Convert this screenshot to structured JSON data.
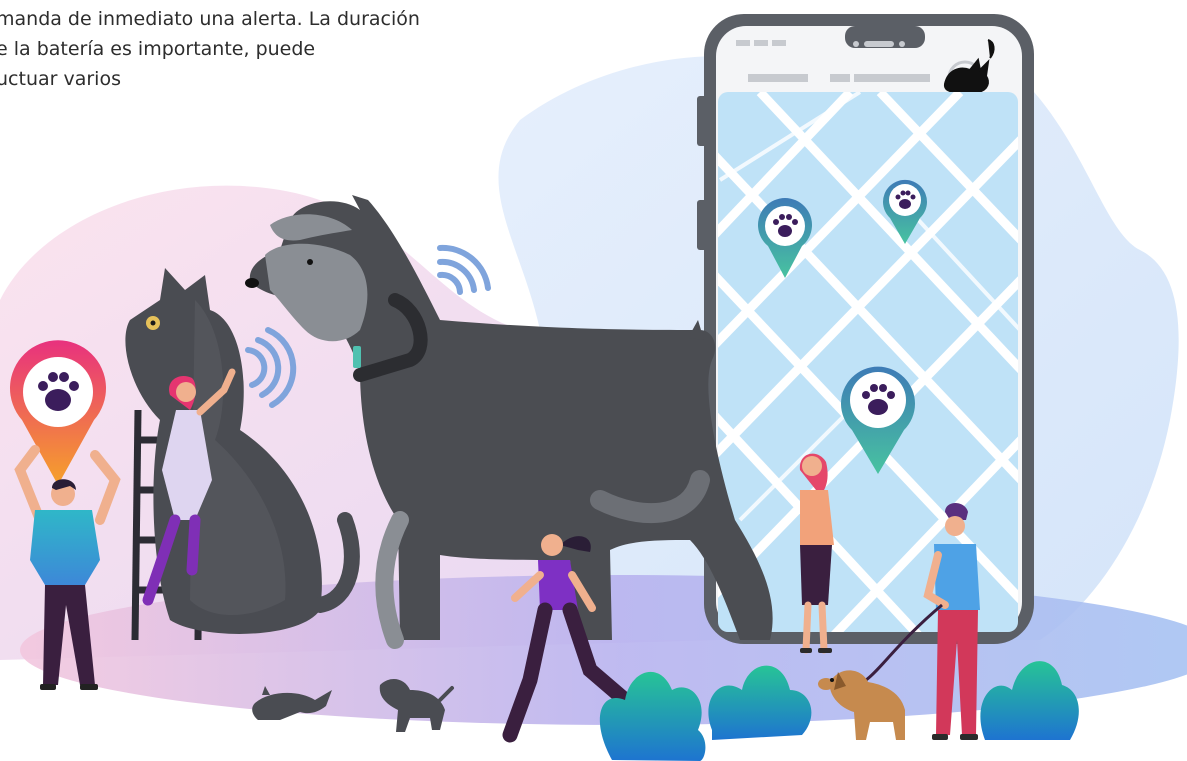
{
  "text_fragment": {
    "lines": [
      "manda de inmediato una alerta. La duración",
      "e la batería es importante, puede",
      "uctuar varios"
    ]
  },
  "illustration": {
    "colors": {
      "blob_pink": "#f6d7e6",
      "blob_blue": "#dbe9fb",
      "floor": "#b8b6f2",
      "phone_frame": "#5b5f66",
      "map_background": "#bfe2f7",
      "map_street": "#ffffff",
      "pin_outer": "#3e7bb6",
      "pin_inner": "#ffffff",
      "paw": "#3b1d5c",
      "dog_dark": "#4b4d52",
      "dog_light": "#8a8e94",
      "cat": "#4a4c52",
      "plant_green": "#2bbf9a",
      "plant_blue": "#1f7fd1",
      "brand_gradient_start": "#e8317e",
      "brand_gradient_end": "#f6a12a"
    },
    "icons": [
      "cat-silhouette-icon",
      "paw-pin-icon",
      "signal-waves-icon"
    ]
  }
}
